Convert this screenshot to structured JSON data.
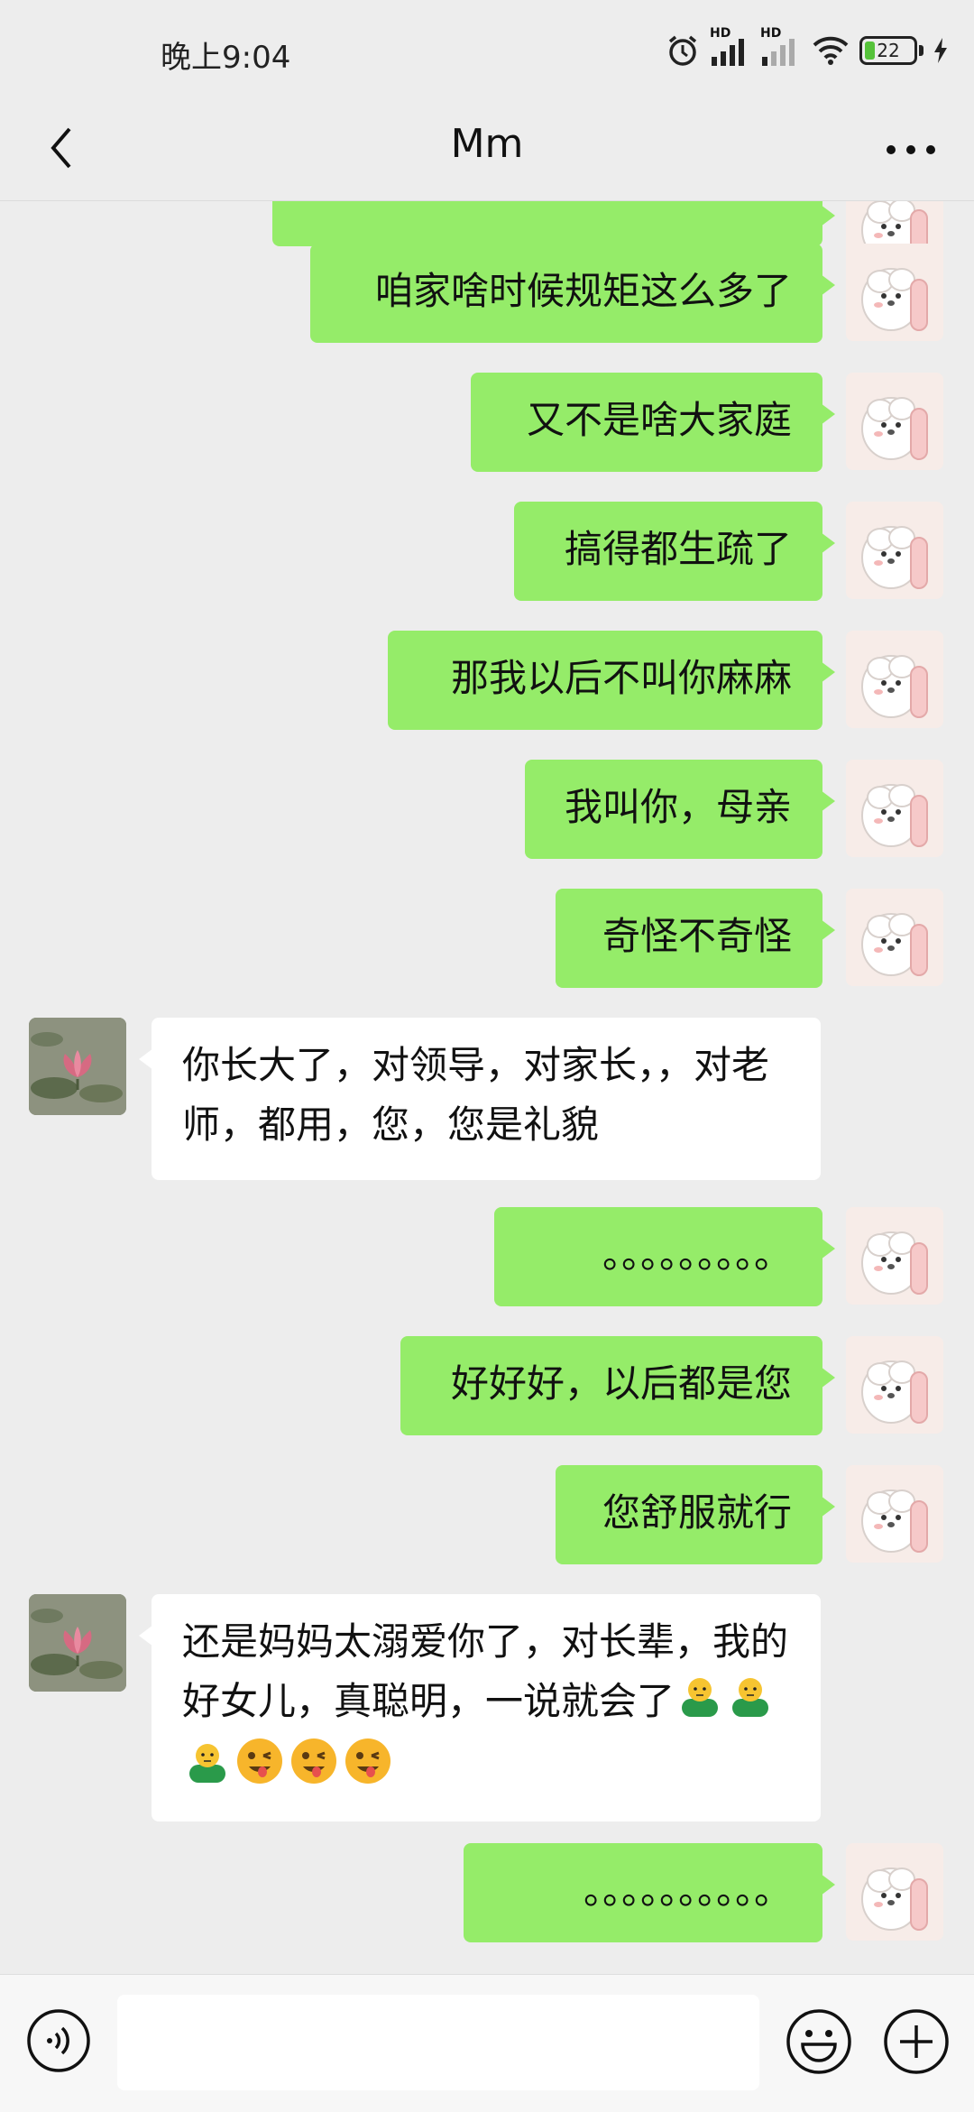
{
  "status_bar": {
    "time": "晚上9:04",
    "battery": "22",
    "battery_level": 0.22,
    "signal1_label": "HD",
    "signal2_label": "HD"
  },
  "header": {
    "title": "Mm"
  },
  "messages": [
    {
      "side": "out",
      "text": ""
    },
    {
      "side": "out",
      "text": "咱家啥时候规矩这么多了"
    },
    {
      "side": "out",
      "text": "又不是啥大家庭"
    },
    {
      "side": "out",
      "text": "搞得都生疏了"
    },
    {
      "side": "out",
      "text": "那我以后不叫你麻麻"
    },
    {
      "side": "out",
      "text": "我叫你，母亲"
    },
    {
      "side": "out",
      "text": "奇怪不奇怪"
    },
    {
      "side": "in",
      "text": "你长大了，对领导，对家长，，对老师，都用，您，您是礼貌"
    },
    {
      "side": "out",
      "text": "。。。。。。。。。"
    },
    {
      "side": "out",
      "text": "好好好，以后都是您"
    },
    {
      "side": "out",
      "text": "您舒服就行"
    },
    {
      "side": "in",
      "text": "还是妈妈太溺爱你了，对长辈，我的好女儿，真聪明，一说就会了",
      "emojis": [
        "bust-emoji",
        "bust-emoji",
        "bust-emoji",
        "wink-tongue-emoji",
        "wink-tongue-emoji",
        "wink-tongue-emoji"
      ]
    },
    {
      "side": "out",
      "text": "。。。。。。。。。。"
    }
  ],
  "input": {
    "value": ""
  },
  "colors": {
    "outgoing_bubble": "#95ec69",
    "incoming_bubble": "#ffffff",
    "background": "#ededed"
  },
  "icons": {
    "back": "chevron-left-icon",
    "more": "more-dots-icon",
    "voice": "voice-icon",
    "emoji": "smiley-icon",
    "plus": "plus-icon",
    "my_avatar": "white-puppy-avatar",
    "their_avatar": "lotus-flower-avatar"
  }
}
